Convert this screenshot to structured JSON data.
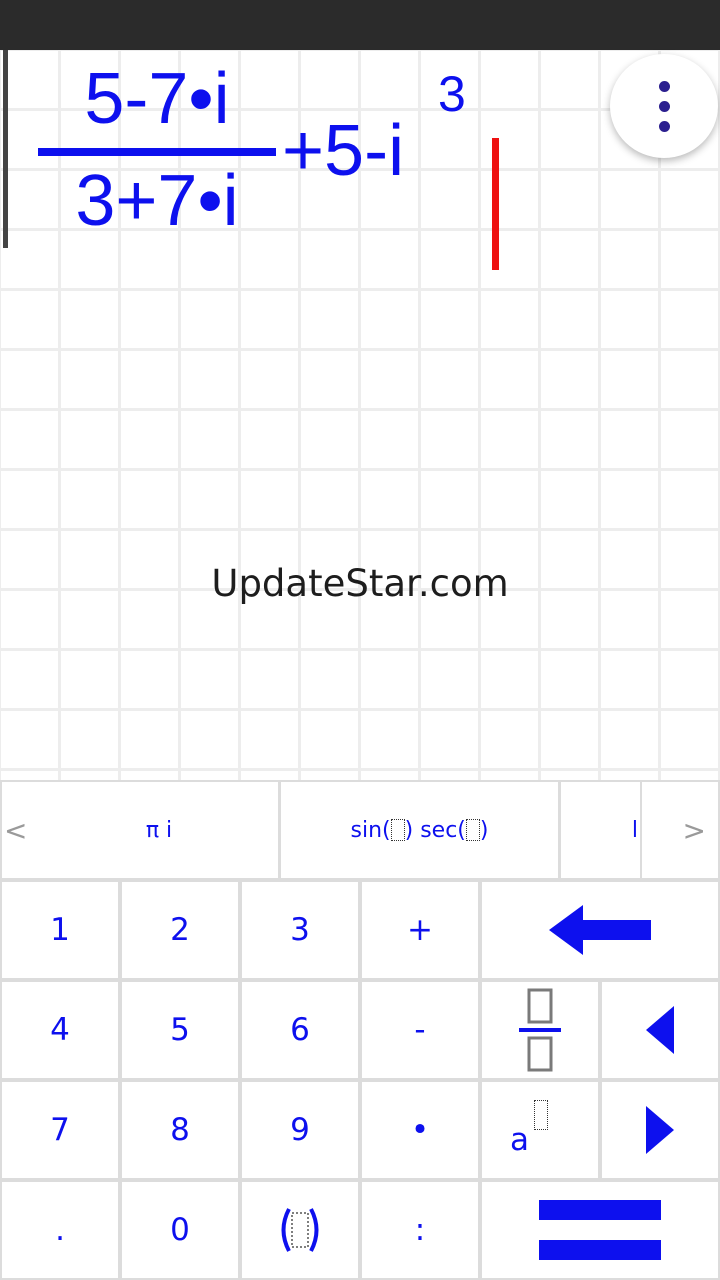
{
  "expression": {
    "numerator": "5-7•i",
    "denominator": "3+7•i",
    "tail": "+5-i",
    "exponent": "3"
  },
  "watermark": "UpdateStar.com",
  "function_bar": {
    "left_arrow": "<",
    "cell_1": "π i",
    "cell_2_a": "sin(",
    "cell_2_b": ") sec(",
    "cell_2_c": ")",
    "cell_3": "l",
    "right_arrow": ">"
  },
  "keys": {
    "one": "1",
    "two": "2",
    "three": "3",
    "plus": "+",
    "four": "4",
    "five": "5",
    "six": "6",
    "minus": "-",
    "seven": "7",
    "eight": "8",
    "nine": "9",
    "times": "•",
    "decimal": ".",
    "zero": "0",
    "divide": ":",
    "power_base": "a"
  },
  "icons": {
    "backspace": "arrow-left-icon",
    "cursor_left": "triangle-left-icon",
    "cursor_right": "triangle-right-icon",
    "equals": "equals-icon",
    "menu": "more-vertical-icon"
  },
  "colors": {
    "accent": "#0d10ee",
    "cursor": "#ee1111",
    "status_bar": "#2b2b2b"
  }
}
